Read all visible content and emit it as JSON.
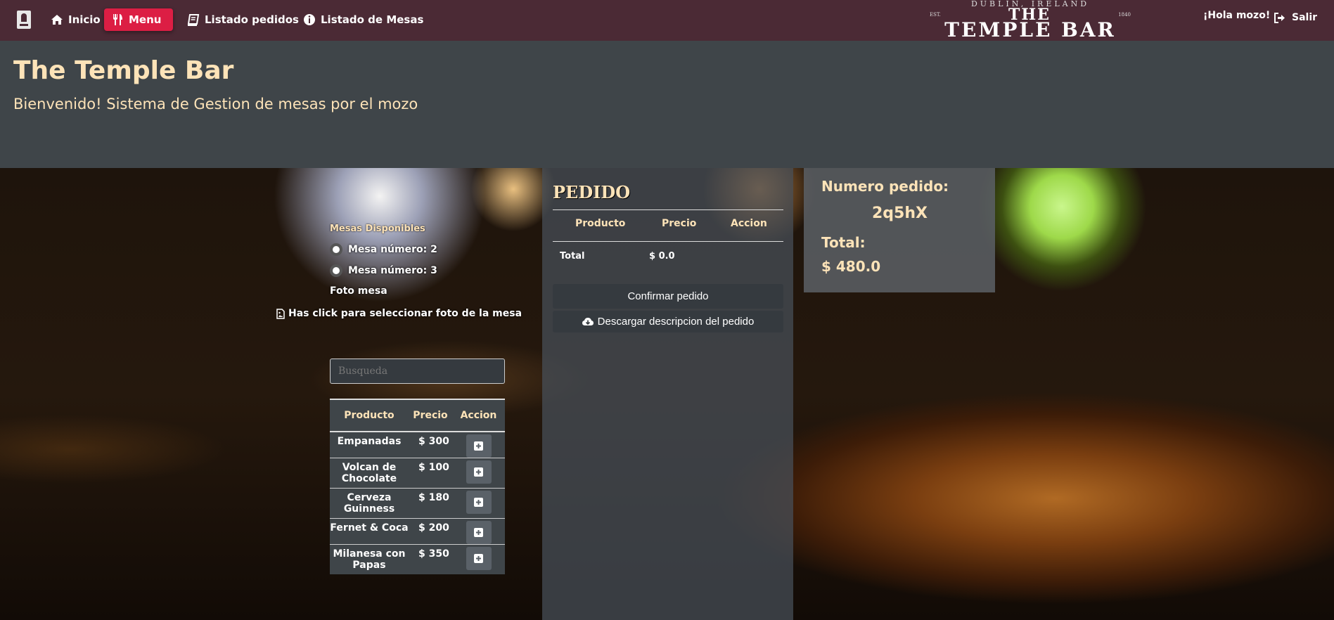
{
  "navbar": {
    "items": [
      {
        "label": "Inicio",
        "icon": "home-icon"
      },
      {
        "label": "Menu",
        "icon": "utensils-icon"
      },
      {
        "label": "Listado pedidos",
        "icon": "book-icon"
      },
      {
        "label": "Listado de Mesas",
        "icon": "info-circle-icon"
      }
    ],
    "active_item": "Menu",
    "logo": {
      "top": "DUBLIN, IRELAND",
      "est": "EST.",
      "year": "1840",
      "the": "THE",
      "main": "TEMPLE BAR"
    },
    "greeting": "¡Hola mozo!",
    "logout_label": "Salir",
    "accent_color": "#dc1e44",
    "bar_color": "#4b2a35"
  },
  "header": {
    "title": "The Temple Bar",
    "subtitle": "Bienvenido! Sistema de Gestion de mesas por el mozo"
  },
  "mesas": {
    "label": "Mesas Disponibles",
    "options": [
      "Mesa número: 2",
      "Mesa número: 3"
    ],
    "foto_label": "Foto mesa",
    "foto_select": "Has click para seleccionar foto de la mesa"
  },
  "search": {
    "placeholder": "Busqueda"
  },
  "menu_table": {
    "headers": [
      "Producto",
      "Precio",
      "Accion"
    ],
    "rows": [
      {
        "producto": "Empanadas",
        "precio": "$ 300"
      },
      {
        "producto": "Volcan de Chocolate",
        "precio": "$ 100"
      },
      {
        "producto": "Cerveza Guinness",
        "precio": "$ 180"
      },
      {
        "producto": "Fernet & Coca",
        "precio": "$ 200"
      },
      {
        "producto": "Milanesa con Papas",
        "precio": "$ 350"
      }
    ]
  },
  "pedido": {
    "title": "PEDIDO",
    "headers": [
      "Producto",
      "Precio",
      "Accion"
    ],
    "total_label": "Total",
    "total_value": "$ 0.0",
    "confirm_label": "Confirmar pedido",
    "download_label": "Descargar descripcion del pedido"
  },
  "info": {
    "numero_label": "Numero pedido:",
    "numero_value": "2q5hX",
    "total_label": "Total:",
    "total_value": "$ 480.0"
  }
}
